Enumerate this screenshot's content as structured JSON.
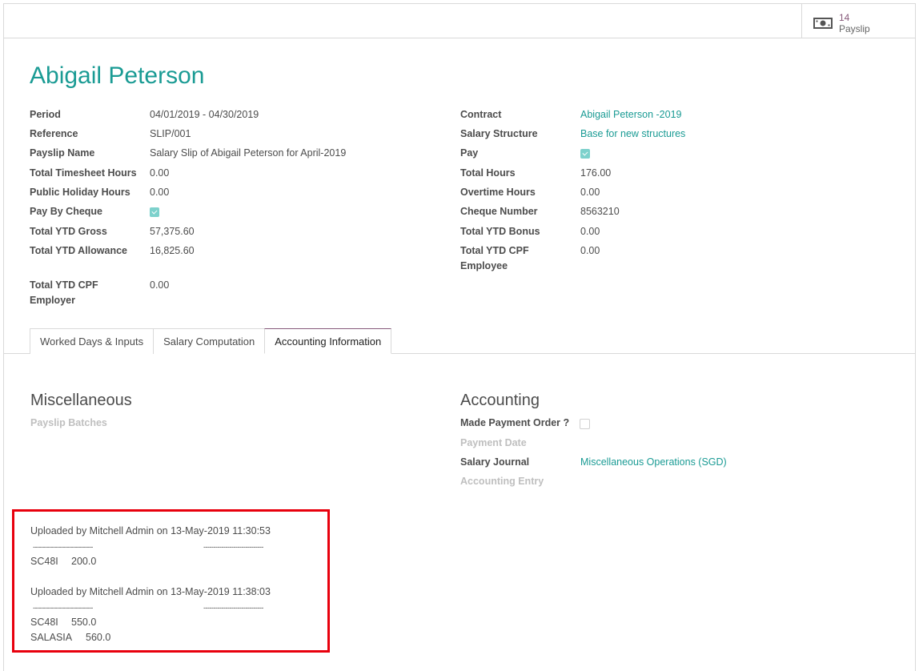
{
  "smart_button": {
    "count": "14",
    "label": "Payslip"
  },
  "employee_name": "Abigail Peterson",
  "left_fields": [
    {
      "label": "Period",
      "value": "04/01/2019 - 04/30/2019"
    },
    {
      "label": "Reference",
      "value": "SLIP/001"
    },
    {
      "label": "Payslip Name",
      "value": "Salary Slip of Abigail Peterson for April-2019"
    },
    {
      "label": "Total Timesheet Hours",
      "value": "0.00"
    },
    {
      "label": "Public Holiday Hours",
      "value": "0.00"
    },
    {
      "label": "Pay By Cheque",
      "checked": true
    },
    {
      "label": "Total YTD Gross",
      "value": "57,375.60"
    },
    {
      "label": "Total YTD Allowance",
      "value": "16,825.60"
    },
    {
      "label_line1": "Total YTD CPF",
      "label_line2": "Employer",
      "value": "0.00"
    }
  ],
  "right_fields": [
    {
      "label": "Contract",
      "value": "Abigail Peterson -2019"
    },
    {
      "label": "Salary Structure",
      "value": "Base for new structures"
    },
    {
      "label": "Pay",
      "checked": true
    },
    {
      "label": "Total Hours",
      "value": "176.00"
    },
    {
      "label": "Overtime Hours",
      "value": "0.00"
    },
    {
      "label": "Cheque Number",
      "value": "8563210"
    },
    {
      "label": "Total YTD Bonus",
      "value": "0.00"
    },
    {
      "label_line1": "Total YTD CPF",
      "label_line2": "Employee",
      "value": "0.00"
    }
  ],
  "tabs": [
    {
      "label": "Worked Days & Inputs"
    },
    {
      "label": "Salary Computation"
    },
    {
      "label": "Accounting Information",
      "active": true
    }
  ],
  "misc": {
    "title": "Miscellaneous",
    "batches_label": "Payslip Batches"
  },
  "accounting": {
    "title": "Accounting",
    "payment_order_label": "Made Payment Order ?",
    "payment_order_checked": false,
    "payment_date_label": "Payment Date",
    "journal_label": "Salary Journal",
    "journal_value": "Miscellaneous Operations (SGD)",
    "entry_label": "Accounting Entry"
  },
  "notes": {
    "upload1": "Uploaded by Mitchell Admin on 13-May-2019 11:30:53",
    "upload1_rows": [
      {
        "code": "SC48I",
        "amount": "200.0"
      }
    ],
    "upload2": "Uploaded by Mitchell Admin on 13-May-2019 11:38:03",
    "upload2_rows": [
      {
        "code": "SC48I",
        "amount": "550.0"
      },
      {
        "code": "SALASIA",
        "amount": "560.0"
      }
    ],
    "dashes": "------------------------------"
  },
  "colors": {
    "accent": "#1a9b94",
    "brand": "#875a7b",
    "highlight_border": "#e8000d"
  }
}
